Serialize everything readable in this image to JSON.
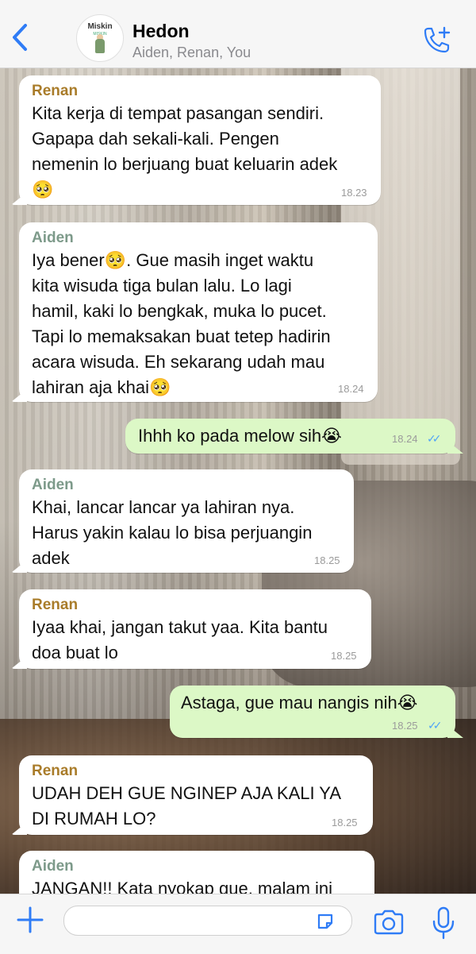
{
  "header": {
    "title": "Hedon",
    "subtitle": "Aiden, Renan, You",
    "avatar_text": "Miskin",
    "avatar_subtext": "MISKIN",
    "back_icon": "chevron-left-icon",
    "call_icon": "phone-plus-icon"
  },
  "messages": [
    {
      "sender": "Renan",
      "text": "Kita kerja di tempat pasangan sendiri.\nGapapa dah sekali-kali. Pengen\nnemenin lo berjuang buat keluarin adek\n🥺",
      "time": "18.23"
    },
    {
      "sender": "Aiden",
      "text": "Iya bener🥺. Gue masih inget waktu\nkita wisuda tiga bulan lalu. Lo lagi\nhamil, kaki lo bengkak, muka lo pucet.\nTapi lo memaksakan buat tetep hadirin\nacara wisuda. Eh sekarang udah mau\nlahiran aja khai🥺",
      "time": "18.24"
    },
    {
      "sender": "You",
      "text": "Ihhh ko pada melow sih😭",
      "time": "18.24"
    },
    {
      "sender": "Aiden",
      "text": "Khai, lancar lancar ya lahiran nya.\nHarus yakin kalau lo bisa perjuangin\nadek",
      "time": "18.25"
    },
    {
      "sender": "Renan",
      "text": "Iyaa khai, jangan takut yaa. Kita bantu\ndoa buat lo",
      "time": "18.25"
    },
    {
      "sender": "You",
      "text": "Astaga, gue mau nangis nih😭",
      "time": "18.25"
    },
    {
      "sender": "Renan",
      "text": "UDAH DEH GUE NGINEP AJA KALI YA\nDI RUMAH LO?",
      "time": "18.25"
    },
    {
      "sender": "Aiden",
      "text": "JANGAN!! Kata nyokap gue, malam ini",
      "time": ""
    }
  ],
  "read_ticks": "✓✓",
  "colors": {
    "accent": "#2f7cf6",
    "outgoing_bubble": "#dcf8c6",
    "incoming_bubble": "#ffffff",
    "renan": "#a97c2a",
    "aiden": "#7d9a8a"
  },
  "bottom_bar": {
    "icons": [
      "plus-icon",
      "sticker-icon",
      "camera-icon",
      "microphone-icon"
    ]
  }
}
